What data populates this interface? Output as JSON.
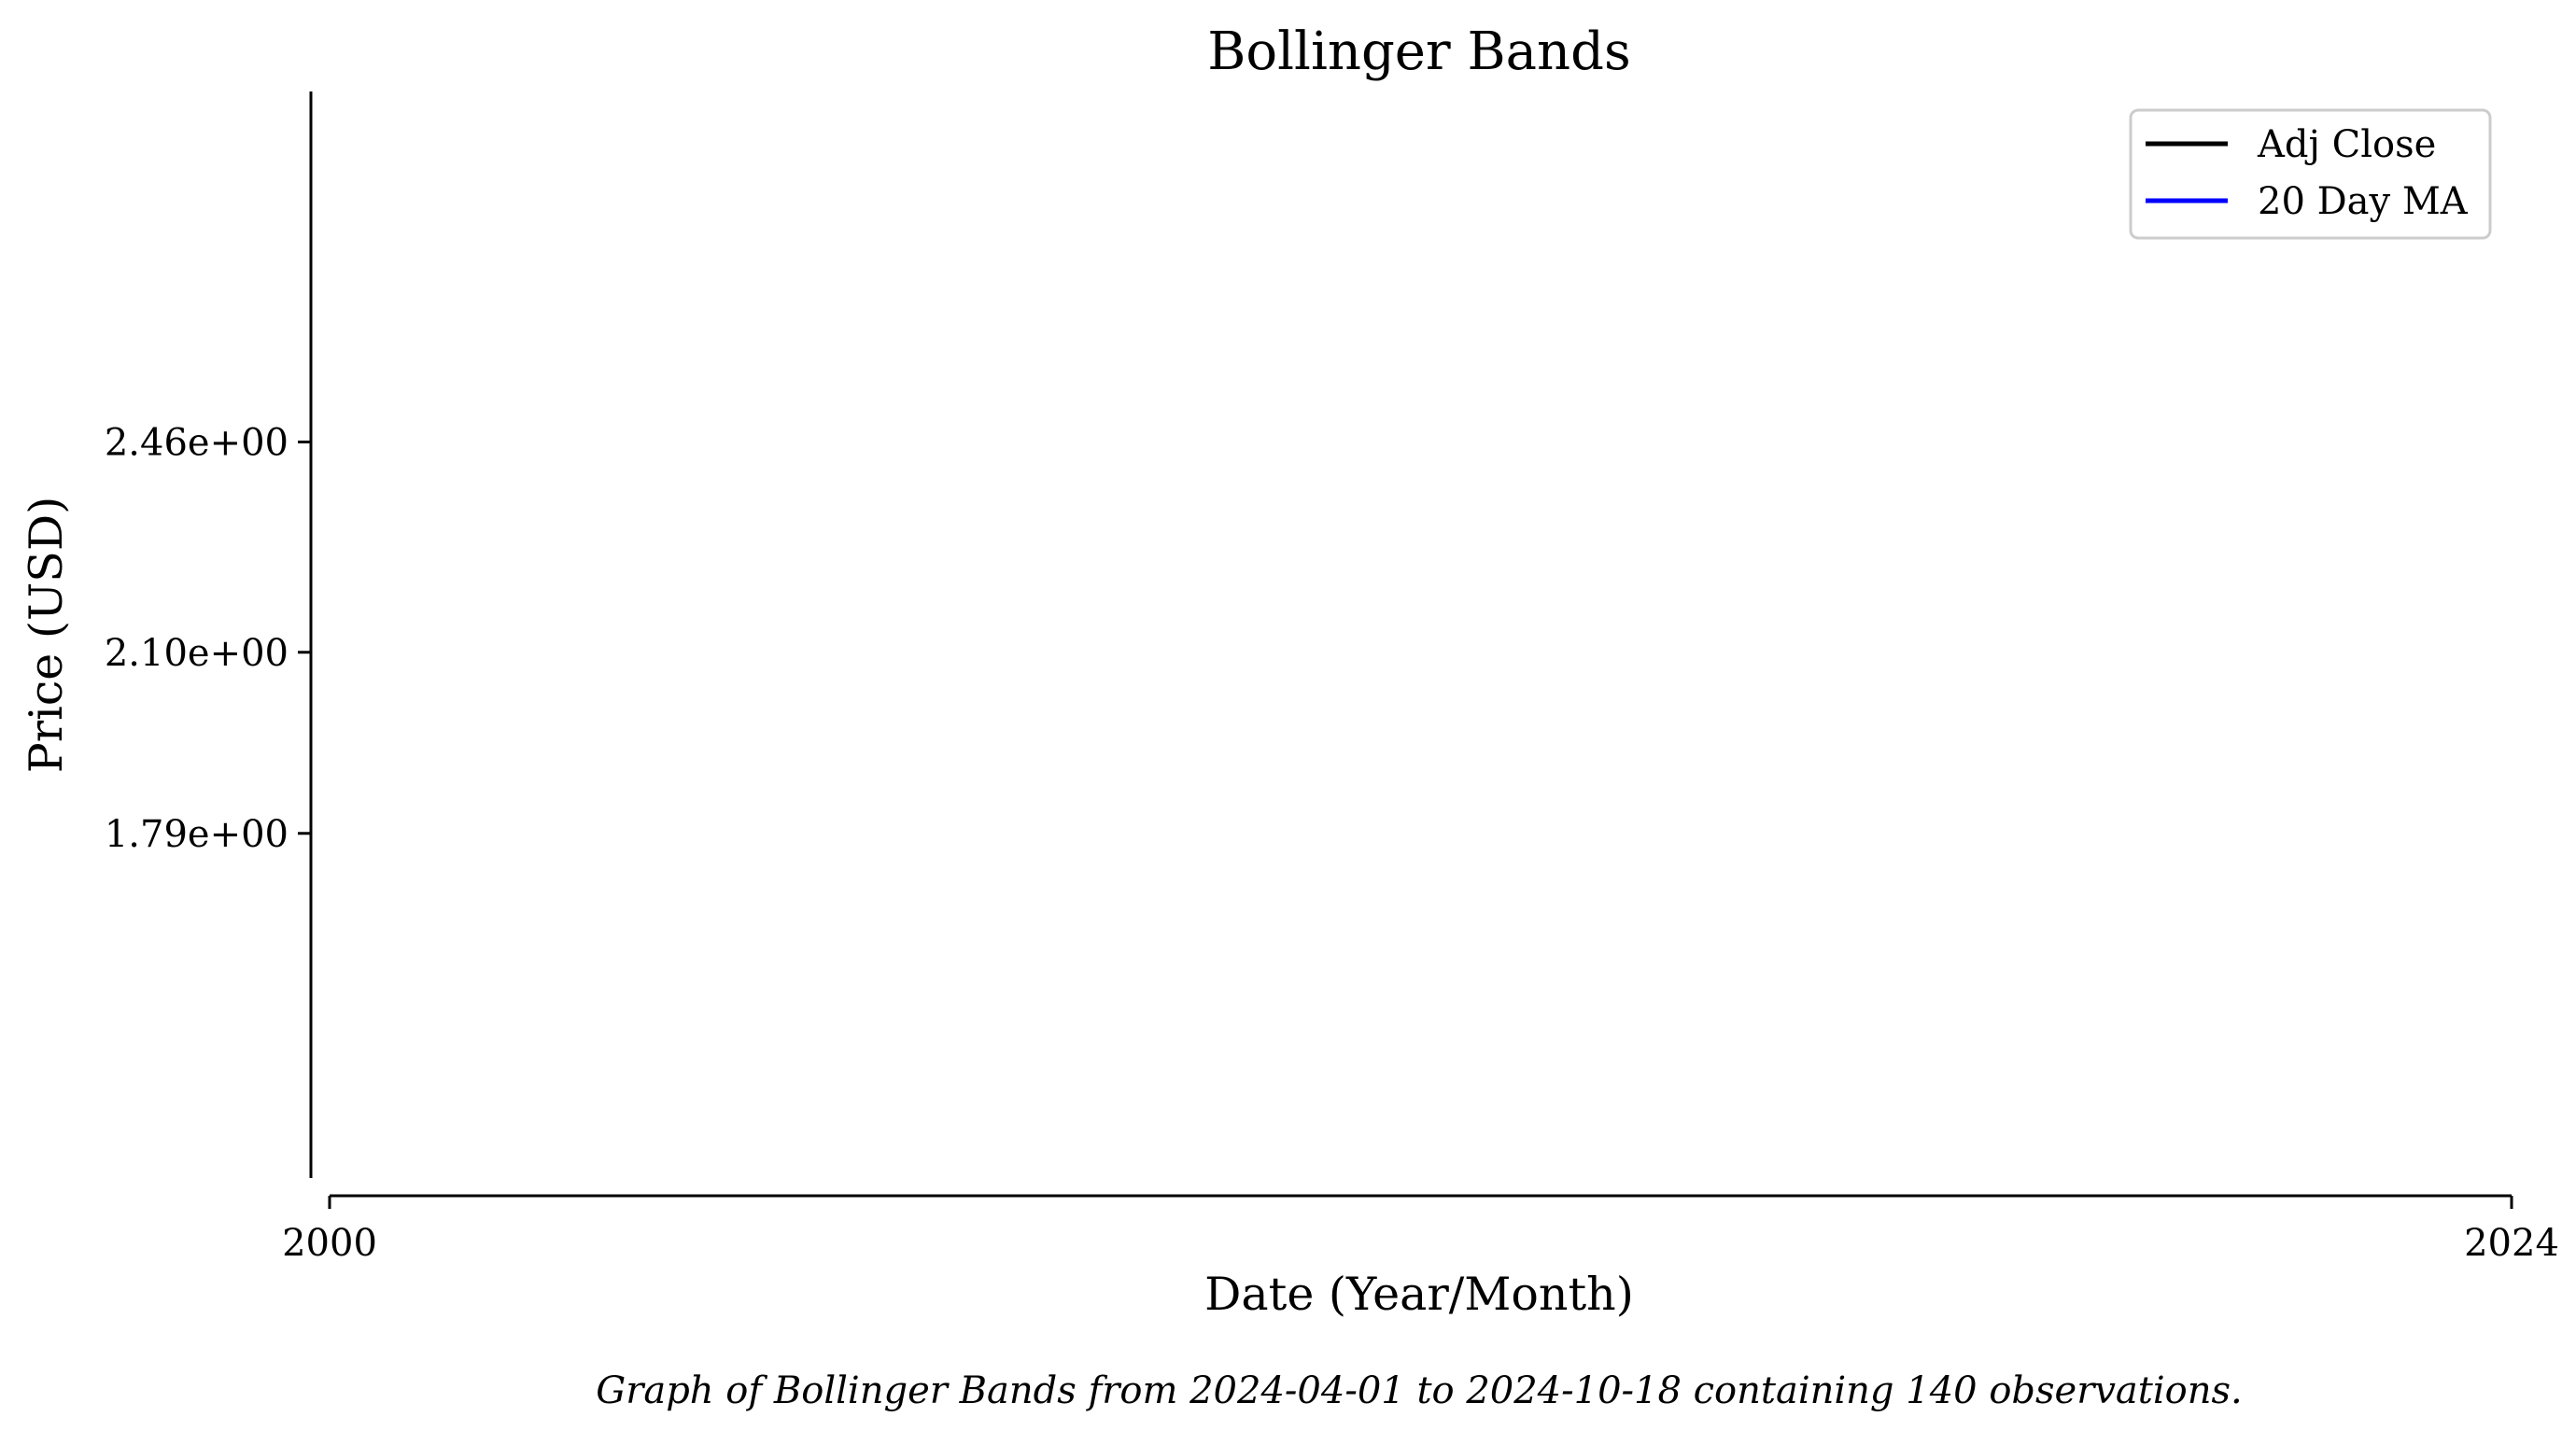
{
  "chart_data": {
    "type": "line",
    "title": "Bollinger Bands",
    "xlabel": "Date (Year/Month)",
    "ylabel": "Price (USD)",
    "caption": "Graph of Bollinger Bands from 2024-04-01 to 2024-10-18 containing 140 observations.",
    "x_ticks": [
      "2000",
      "2024"
    ],
    "xlim": [
      2000,
      2024
    ],
    "y_ticks": [
      {
        "value": 1.79,
        "label": "1.79e+00"
      },
      {
        "value": 2.1,
        "label": "2.10e+00"
      },
      {
        "value": 2.46,
        "label": "2.46e+00"
      }
    ],
    "ylim": [
      1.2,
      3.06
    ],
    "grid": false,
    "legend_position": "upper right",
    "series": [
      {
        "name": "Adj Close",
        "color": "#000000",
        "values": []
      },
      {
        "name": "20 Day MA",
        "color": "#0000ff",
        "values": []
      }
    ]
  }
}
